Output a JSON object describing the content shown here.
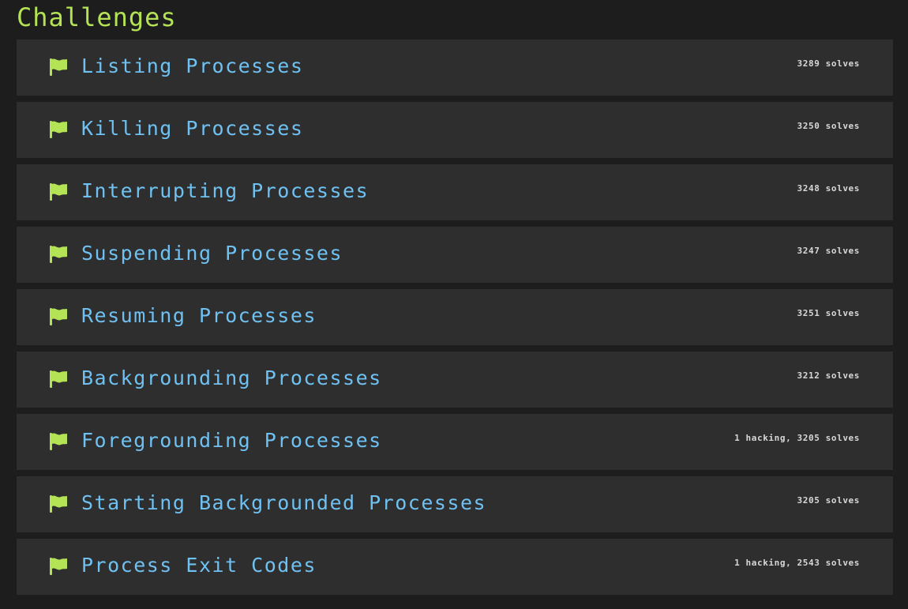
{
  "colors": {
    "accent": "#b4e355",
    "link": "#6fc1f2",
    "background": "#1d1d1d",
    "card": "#2e2e2e",
    "muted": "#d8d8d8"
  },
  "heading": "Challenges",
  "challenges": [
    {
      "icon": "flag-icon",
      "name": "Listing Processes",
      "stats": "3289 solves"
    },
    {
      "icon": "flag-icon",
      "name": "Killing Processes",
      "stats": "3250 solves"
    },
    {
      "icon": "flag-icon",
      "name": "Interrupting Processes",
      "stats": "3248 solves"
    },
    {
      "icon": "flag-icon",
      "name": "Suspending Processes",
      "stats": "3247 solves"
    },
    {
      "icon": "flag-icon",
      "name": "Resuming Processes",
      "stats": "3251 solves"
    },
    {
      "icon": "flag-icon",
      "name": "Backgrounding Processes",
      "stats": "3212 solves"
    },
    {
      "icon": "flag-icon",
      "name": "Foregrounding Processes",
      "stats": "1 hacking, 3205 solves"
    },
    {
      "icon": "flag-icon",
      "name": "Starting Backgrounded Processes",
      "stats": "3205 solves"
    },
    {
      "icon": "flag-icon",
      "name": "Process Exit Codes",
      "stats": "1 hacking, 2543 solves"
    }
  ]
}
